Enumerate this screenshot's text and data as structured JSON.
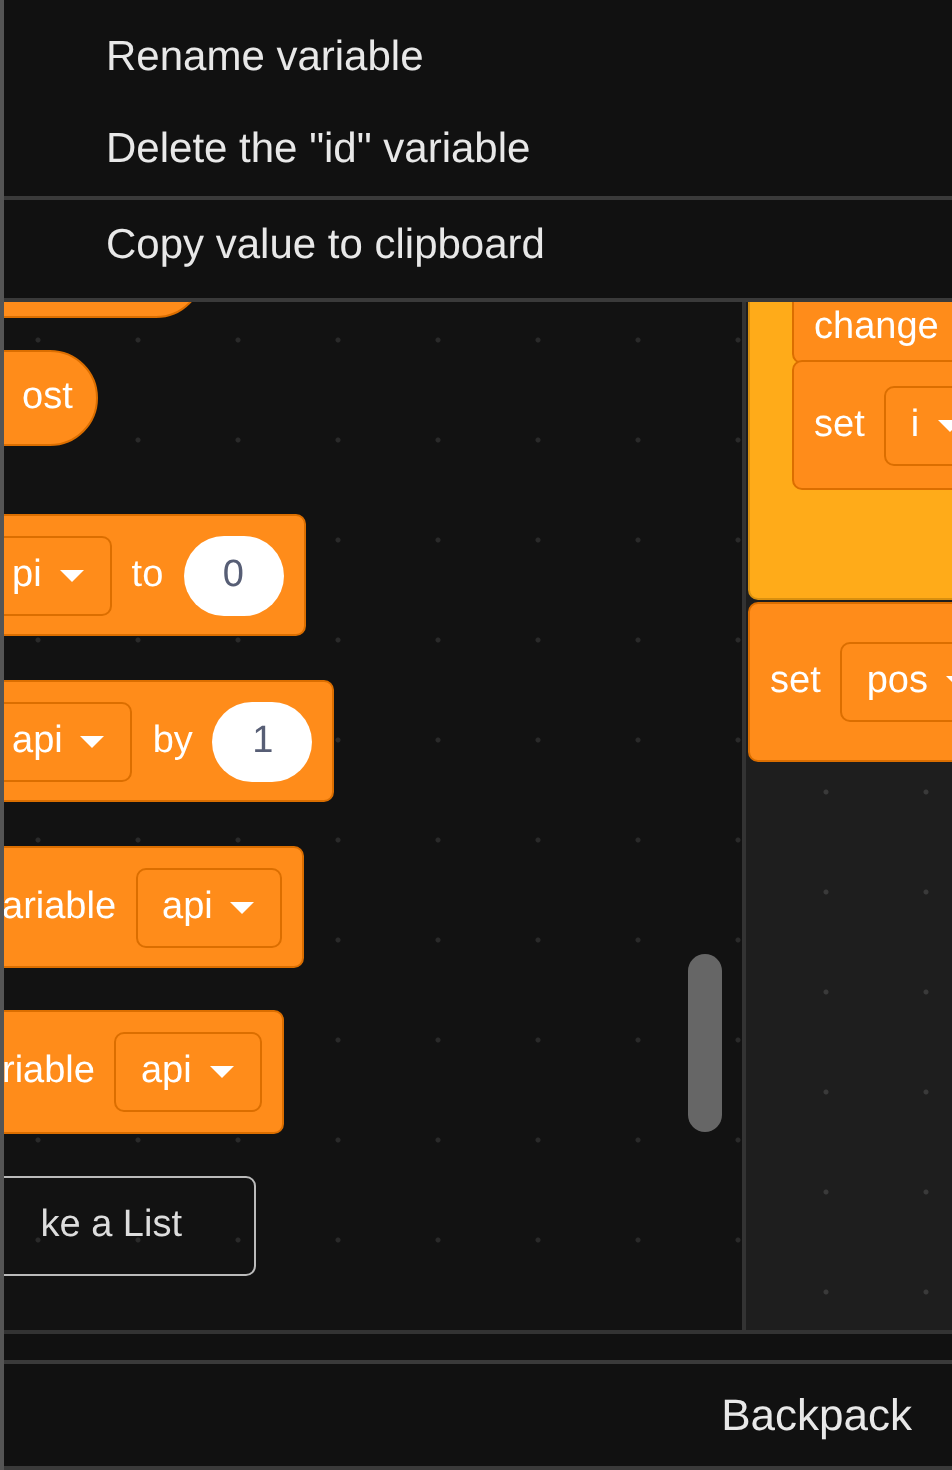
{
  "context_menu": {
    "sections": [
      [
        {
          "label": "Rename variable"
        },
        {
          "label": "Delete the \"id\" variable"
        }
      ],
      [
        {
          "label": "Copy value to clipboard"
        }
      ]
    ]
  },
  "palette": {
    "blocks": [
      {
        "kind": "reporter",
        "parts": [
          {
            "kind": "label",
            "text": "ost"
          }
        ]
      },
      {
        "kind": "command",
        "parts": [
          {
            "kind": "dropdown",
            "text": "pi"
          },
          {
            "kind": "label",
            "text": "to"
          },
          {
            "kind": "input",
            "text": "0"
          }
        ]
      },
      {
        "kind": "command",
        "parts": [
          {
            "kind": "dropdown",
            "text": "api"
          },
          {
            "kind": "label",
            "text": "by"
          },
          {
            "kind": "input",
            "text": "1"
          }
        ]
      },
      {
        "kind": "command",
        "parts": [
          {
            "kind": "label",
            "text": "ariable"
          },
          {
            "kind": "dropdown",
            "text": "api"
          }
        ]
      },
      {
        "kind": "command",
        "parts": [
          {
            "kind": "label",
            "text": "riable"
          },
          {
            "kind": "dropdown",
            "text": "api"
          }
        ]
      }
    ],
    "make_list_button": {
      "label": "ke a List"
    }
  },
  "script_area": {
    "blocks": [
      {
        "kind": "c-block",
        "children": [
          {
            "kind": "command",
            "parts": [
              {
                "kind": "label",
                "text": "change"
              }
            ]
          },
          {
            "kind": "command",
            "parts": [
              {
                "kind": "label",
                "text": "set"
              },
              {
                "kind": "dropdown",
                "text": "i"
              }
            ]
          }
        ]
      },
      {
        "kind": "command",
        "parts": [
          {
            "kind": "label",
            "text": "set"
          },
          {
            "kind": "dropdown",
            "text": "pos"
          }
        ]
      }
    ]
  },
  "backpack": {
    "label": "Backpack"
  }
}
